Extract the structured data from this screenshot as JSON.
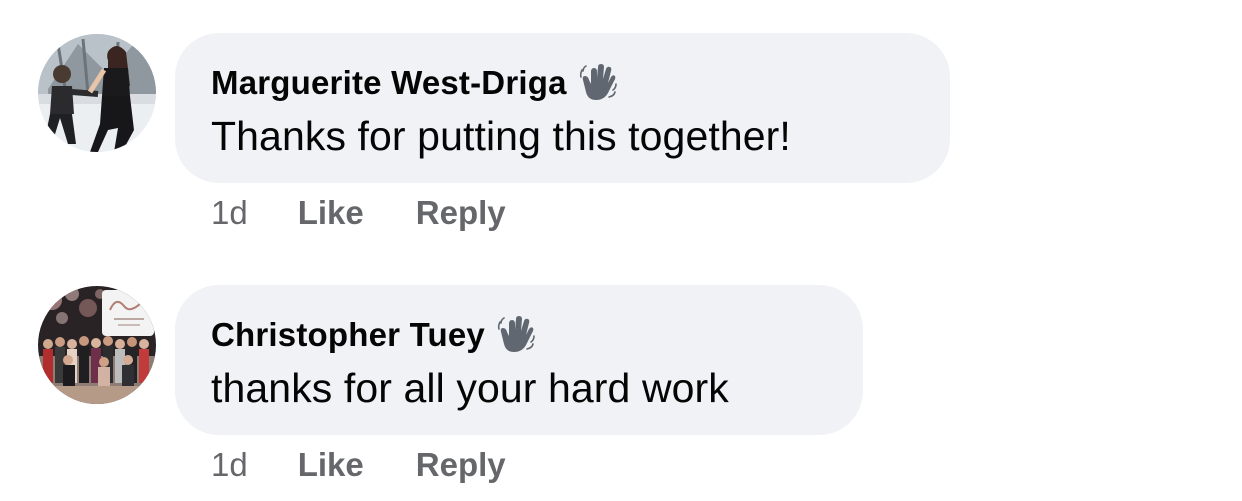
{
  "comments": [
    {
      "author": "Marguerite West-Driga",
      "text": "Thanks for putting this together!",
      "time": "1d",
      "like_label": "Like",
      "reply_label": "Reply",
      "badge_icon": "wave-icon"
    },
    {
      "author": "Christopher Tuey",
      "text": "thanks for all your hard work",
      "time": "1d",
      "like_label": "Like",
      "reply_label": "Reply",
      "badge_icon": "wave-icon"
    }
  ],
  "colors": {
    "bubble_bg": "#f0f2f5",
    "text_primary": "#050505",
    "text_secondary": "#65676b"
  }
}
